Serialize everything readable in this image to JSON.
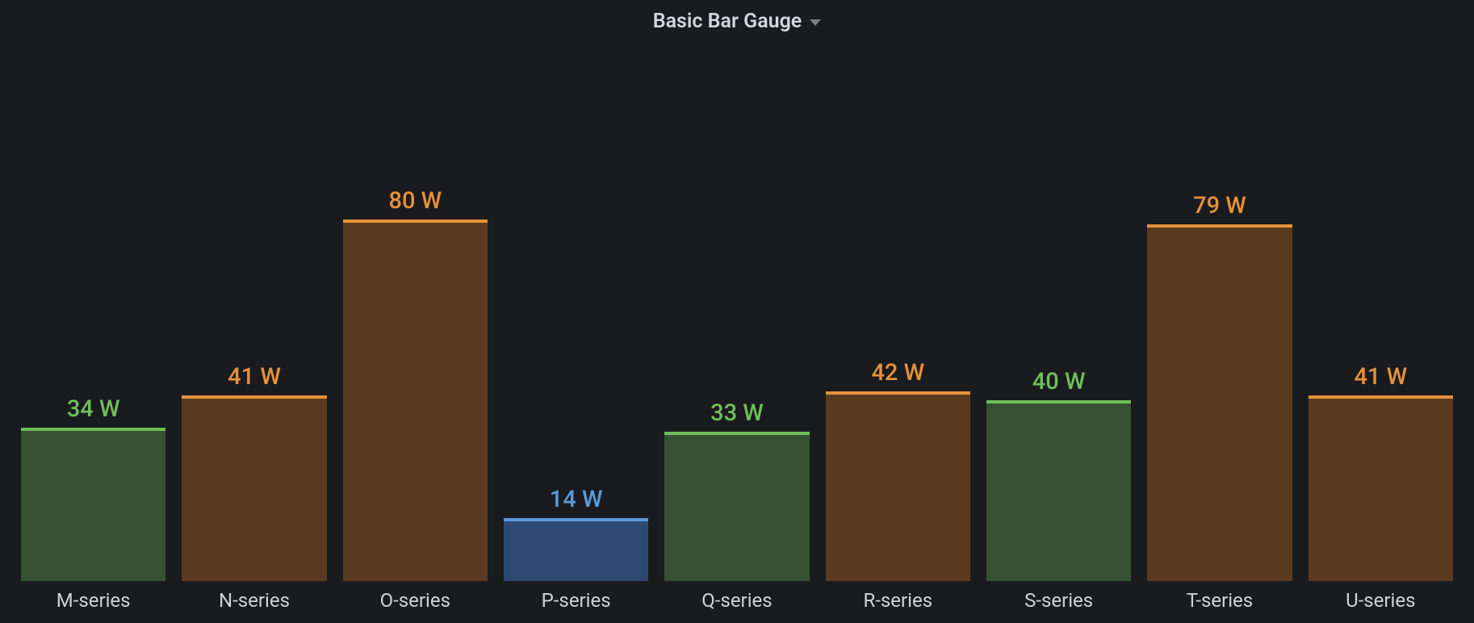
{
  "panel": {
    "title": "Basic Bar Gauge"
  },
  "colors": {
    "blue": {
      "text": "#5a9bdc",
      "fill": "#2d4a73",
      "top": "#5a9bdc"
    },
    "green": {
      "text": "#6fbf59",
      "fill": "#355131",
      "top": "#6fbf59"
    },
    "orange": {
      "text": "#e69138",
      "fill": "#5a3b20",
      "top": "#e69138"
    }
  },
  "chart_data": {
    "type": "bar",
    "title": "Basic Bar Gauge",
    "unit": "W",
    "ylim": [
      0,
      100
    ],
    "categories": [
      "M-series",
      "N-series",
      "O-series",
      "P-series",
      "Q-series",
      "R-series",
      "S-series",
      "T-series",
      "U-series"
    ],
    "values": [
      34,
      41,
      80,
      14,
      33,
      42,
      40,
      79,
      41
    ],
    "series_colors": [
      "green",
      "orange",
      "orange",
      "blue",
      "green",
      "orange",
      "green",
      "orange",
      "orange"
    ]
  }
}
